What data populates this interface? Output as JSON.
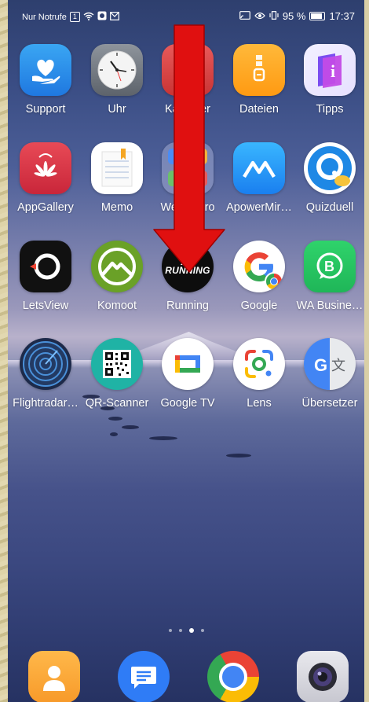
{
  "status_bar": {
    "carrier": "Nur Notrufe",
    "battery_percent": "95 %",
    "time": "17:37"
  },
  "apps": [
    {
      "label": "Support",
      "icon": "heart-hand-icon"
    },
    {
      "label": "Uhr",
      "icon": "clock-icon"
    },
    {
      "label": "Kalender",
      "icon": "calendar-icon"
    },
    {
      "label": "Dateien",
      "icon": "folder-icon"
    },
    {
      "label": "Tipps",
      "icon": "tips-icon"
    },
    {
      "label": "AppGallery",
      "icon": "huawei-bag-icon"
    },
    {
      "label": "Memo",
      "icon": "notepad-icon"
    },
    {
      "label": "Wetter Pro",
      "icon": "weather-folder-icon"
    },
    {
      "label": "ApowerMir…",
      "icon": "apowermirror-icon"
    },
    {
      "label": "Quizduell",
      "icon": "quiz-icon"
    },
    {
      "label": "LetsView",
      "icon": "letsview-icon"
    },
    {
      "label": "Komoot",
      "icon": "komoot-icon"
    },
    {
      "label": "Running",
      "icon": "adidas-running-icon",
      "badge": "RUNNING"
    },
    {
      "label": "Google",
      "icon": "google-icon"
    },
    {
      "label": "WA Busine…",
      "icon": "whatsapp-business-icon"
    },
    {
      "label": "Flightradar…",
      "icon": "flightradar-icon"
    },
    {
      "label": "QR-Scanner",
      "icon": "qr-code-icon"
    },
    {
      "label": "Google TV",
      "icon": "google-tv-icon"
    },
    {
      "label": "Lens",
      "icon": "google-lens-icon"
    },
    {
      "label": "Übersetzer",
      "icon": "translate-icon"
    }
  ],
  "page_indicator": {
    "pages": 4,
    "current": 3
  },
  "dock": [
    {
      "icon": "contacts-icon"
    },
    {
      "icon": "messages-icon"
    },
    {
      "icon": "chrome-icon"
    },
    {
      "icon": "camera-icon"
    }
  ],
  "annotation": {
    "type": "red-arrow",
    "color": "#e01010",
    "points_to": "Running"
  }
}
